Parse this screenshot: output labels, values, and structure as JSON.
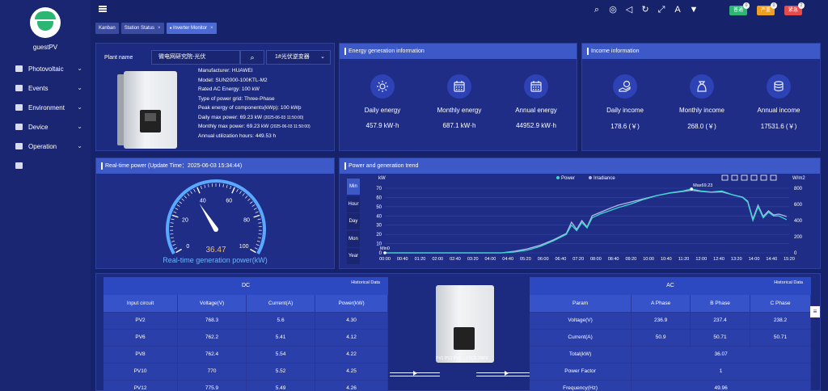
{
  "user": {
    "name": "guestPV"
  },
  "sidebar": {
    "items": [
      {
        "label": "Photovoltaic",
        "icon": "photovoltaic-icon"
      },
      {
        "label": "Events",
        "icon": "events-icon"
      },
      {
        "label": "Environment",
        "icon": "environment-icon"
      },
      {
        "label": "Device",
        "icon": "device-icon"
      },
      {
        "label": "Operation",
        "icon": "operation-icon"
      },
      {
        "label": "",
        "icon": "extra-icon"
      }
    ]
  },
  "topbar": {
    "badges": [
      {
        "label": "普通",
        "count": "0",
        "color": "#2bb673"
      },
      {
        "label": "严重",
        "count": "0",
        "color": "#f0a020"
      },
      {
        "label": "紧急",
        "count": "2",
        "color": "#e64a4a"
      }
    ]
  },
  "tabs": [
    {
      "label": "Kanban",
      "active": false,
      "closable": false
    },
    {
      "label": "Station Status",
      "active": false,
      "closable": true
    },
    {
      "label": "Inverter Monitor",
      "active": true,
      "closable": true
    }
  ],
  "plant": {
    "label": "Plant name",
    "name": "微电网研究院-光伏",
    "inverter": "1#光伏逆变器",
    "specs": [
      {
        "k": "Manufacturer:",
        "v": "HUAWEI",
        "t": ""
      },
      {
        "k": "Model:",
        "v": "SUN2000-100KTL-M2",
        "t": ""
      },
      {
        "k": "Rated AC Energy:",
        "v": "100 kW",
        "t": ""
      },
      {
        "k": "Type of power grid:",
        "v": "Three-Phase",
        "t": ""
      },
      {
        "k": "Peak energy of components(kWp):",
        "v": "100 kWp",
        "t": ""
      },
      {
        "k": "Daily max power:",
        "v": "69.23 kW",
        "t": "(2025-06-03 11:50:00)"
      },
      {
        "k": "Monthly max power:",
        "v": "69.23 kW",
        "t": "(2025-06-03 11:50:00)"
      },
      {
        "k": "Annual utilization hours:",
        "v": "449.53 h",
        "t": ""
      }
    ]
  },
  "energy": {
    "title": "Energy generation information",
    "items": [
      {
        "label": "Daily energy",
        "value": "457.9 kW·h"
      },
      {
        "label": "Monthly energy",
        "value": "687.1 kW·h"
      },
      {
        "label": "Annual energy",
        "value": "44952.9 kW·h"
      }
    ]
  },
  "income": {
    "title": "Income information",
    "items": [
      {
        "label": "Daily income",
        "value": "178.6 (￥)"
      },
      {
        "label": "Monthly income",
        "value": "268.0 (￥)"
      },
      {
        "label": "Annual income",
        "value": "17531.6 (￥)"
      }
    ]
  },
  "realtime": {
    "title": "Real-time power (Update Time：2025-06-03 15:34:44)",
    "value": "36.47",
    "gauge_value": 36.47,
    "gauge_max": 100,
    "ticks": [
      "0",
      "20",
      "40",
      "60",
      "80",
      "100"
    ],
    "label": "Real-time generation power(kW)"
  },
  "trend": {
    "title": "Power and generation trend",
    "buttons": [
      "Min",
      "Hour",
      "Day",
      "Mon",
      "Year"
    ]
  },
  "chart_data": {
    "type": "line",
    "legend": [
      "Power",
      "Irradiance"
    ],
    "ylabel_left": "kW",
    "ylabel_right": "W/m2",
    "ylim_left": [
      0,
      70
    ],
    "ylim_right": [
      0,
      800
    ],
    "yticks_left": [
      "0",
      "10",
      "20",
      "30",
      "40",
      "50",
      "60",
      "70"
    ],
    "yticks_right": [
      "0",
      "200",
      "400",
      "600",
      "800"
    ],
    "xticks": [
      "00:00",
      "00:40",
      "01:20",
      "02:00",
      "02:40",
      "03:20",
      "04:00",
      "04:40",
      "05:20",
      "06:00",
      "06:40",
      "07:20",
      "08:00",
      "08:40",
      "09:20",
      "10:00",
      "10:40",
      "11:20",
      "12:00",
      "12:40",
      "13:20",
      "14:00",
      "14:40",
      "15:20"
    ],
    "annotations": {
      "max": "Max69.23",
      "min": "Min0"
    },
    "power": [
      [
        0,
        0
      ],
      [
        4.5,
        0
      ],
      [
        5.0,
        1
      ],
      [
        5.5,
        3
      ],
      [
        6.0,
        7
      ],
      [
        6.5,
        13
      ],
      [
        7.0,
        20
      ],
      [
        7.2,
        30
      ],
      [
        7.4,
        24
      ],
      [
        7.6,
        33
      ],
      [
        7.8,
        27
      ],
      [
        8.0,
        38
      ],
      [
        8.3,
        42
      ],
      [
        8.6,
        45
      ],
      [
        9.0,
        49
      ],
      [
        9.5,
        53
      ],
      [
        10.0,
        58
      ],
      [
        10.5,
        62
      ],
      [
        11.0,
        65
      ],
      [
        11.5,
        67
      ],
      [
        11.83,
        69.23
      ],
      [
        12.2,
        67
      ],
      [
        12.6,
        66
      ],
      [
        13.0,
        67
      ],
      [
        13.4,
        63
      ],
      [
        13.8,
        60
      ],
      [
        14.0,
        55
      ],
      [
        14.2,
        35
      ],
      [
        14.4,
        50
      ],
      [
        14.6,
        38
      ],
      [
        14.8,
        44
      ],
      [
        15.0,
        40
      ],
      [
        15.2,
        40
      ],
      [
        15.5,
        36
      ]
    ],
    "irradiance": [
      [
        0,
        0
      ],
      [
        4.5,
        0
      ],
      [
        5.0,
        20
      ],
      [
        5.5,
        50
      ],
      [
        6.0,
        95
      ],
      [
        6.5,
        160
      ],
      [
        7.0,
        240
      ],
      [
        7.2,
        380
      ],
      [
        7.4,
        290
      ],
      [
        7.6,
        400
      ],
      [
        7.8,
        320
      ],
      [
        8.0,
        460
      ],
      [
        8.3,
        500
      ],
      [
        8.6,
        540
      ],
      [
        9.0,
        590
      ],
      [
        9.5,
        630
      ],
      [
        10.0,
        670
      ],
      [
        10.5,
        710
      ],
      [
        11.0,
        740
      ],
      [
        11.5,
        760
      ],
      [
        11.83,
        775
      ],
      [
        12.2,
        760
      ],
      [
        12.6,
        750
      ],
      [
        13.0,
        755
      ],
      [
        13.4,
        720
      ],
      [
        13.8,
        690
      ],
      [
        14.0,
        640
      ],
      [
        14.2,
        420
      ],
      [
        14.4,
        590
      ],
      [
        14.6,
        450
      ],
      [
        14.8,
        520
      ],
      [
        15.0,
        470
      ],
      [
        15.2,
        480
      ],
      [
        15.5,
        450
      ]
    ]
  },
  "dc": {
    "title": "DC",
    "historical": "Historical Data",
    "headers": [
      "Input circuit",
      "Voltage(V)",
      "Current(A)",
      "Power(kW)"
    ],
    "rows": [
      [
        "PV2",
        "768.3",
        "5.6",
        "4.30"
      ],
      [
        "PV6",
        "762.2",
        "5.41",
        "4.12"
      ],
      [
        "PV8",
        "762.4",
        "5.54",
        "4.22"
      ],
      [
        "PV10",
        "770",
        "5.52",
        "4.25"
      ],
      [
        "PV12",
        "775.9",
        "5.49",
        "4.26"
      ]
    ]
  },
  "ac": {
    "title": "AC",
    "historical": "Historical Data",
    "headers": [
      "Param",
      "A Phase",
      "B Phase",
      "C Phase"
    ],
    "rows3": [
      [
        "Voltage(V)",
        "236.9",
        "237.4",
        "238.2"
      ],
      [
        "Current(A)",
        "50.9",
        "50.71",
        "50.71"
      ]
    ],
    "rows1": [
      [
        "Total(kW)",
        "36.07"
      ],
      [
        "Power Factor",
        "1"
      ],
      [
        "Frequency(Hz)",
        "49.96"
      ]
    ]
  },
  "diagram": {
    "labels": "PV1 PV2 PV3 ...",
    "ports": "L1L2L3NPE"
  }
}
